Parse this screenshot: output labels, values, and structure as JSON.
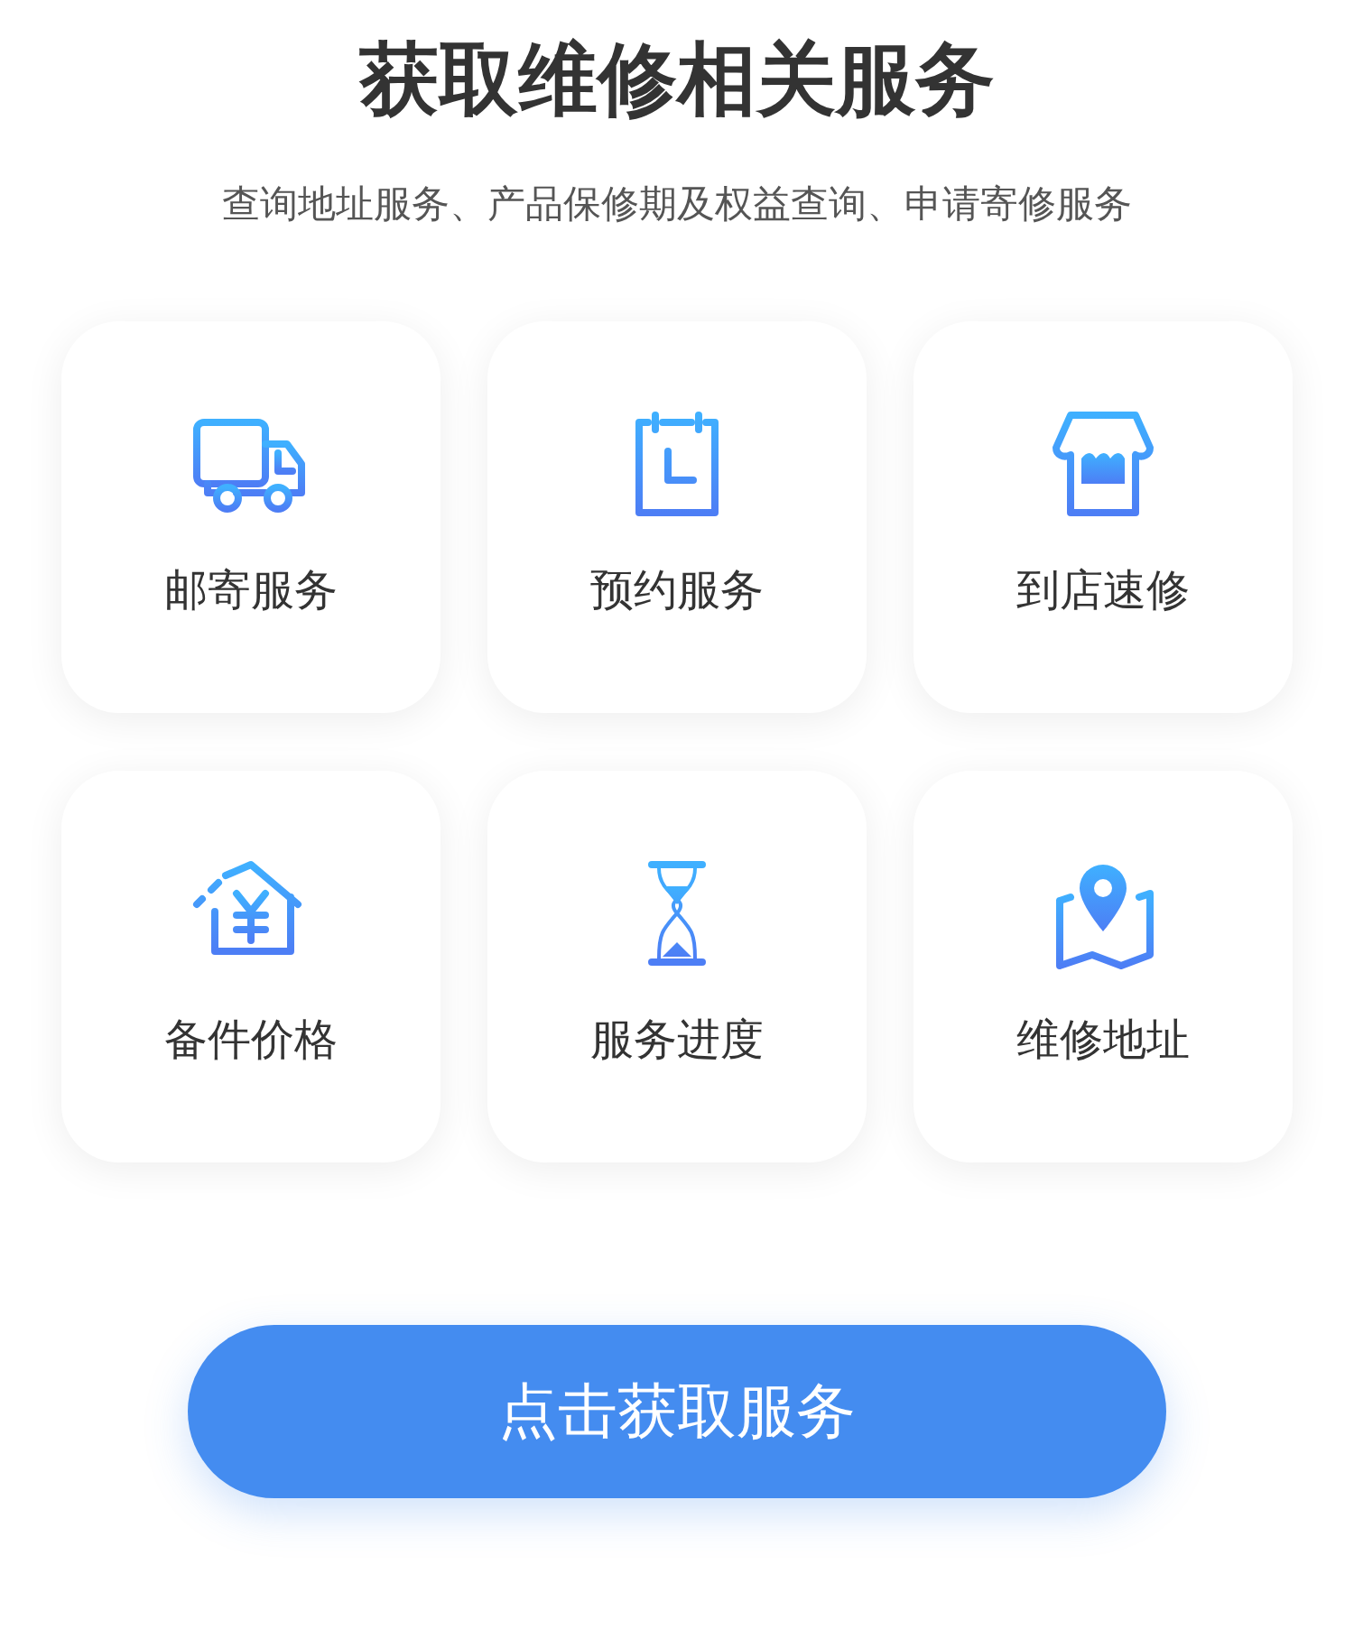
{
  "title": "获取维修相关服务",
  "subtitle": "查询地址服务、产品保修期及权益查询、申请寄修服务",
  "services": [
    {
      "label": "邮寄服务"
    },
    {
      "label": "预约服务"
    },
    {
      "label": "到店速修"
    },
    {
      "label": "备件价格"
    },
    {
      "label": "服务进度"
    },
    {
      "label": "维修地址"
    }
  ],
  "action_button": "点击获取服务"
}
